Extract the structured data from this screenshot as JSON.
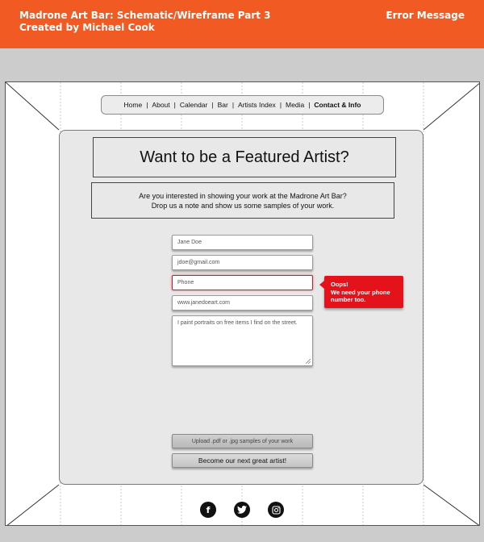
{
  "header": {
    "title_line1": "Madrone Art Bar: Schematic/Wireframe Part 3",
    "title_line2": "Created by Michael Cook",
    "page_label": "Error Message",
    "bg_color": "#f15a22"
  },
  "nav": {
    "items": [
      {
        "label": "Home"
      },
      {
        "label": "About"
      },
      {
        "label": "Calendar"
      },
      {
        "label": "Bar"
      },
      {
        "label": "Artists Index"
      },
      {
        "label": "Media"
      },
      {
        "label": "Contact & Info",
        "active": true
      }
    ],
    "separator": "|"
  },
  "main": {
    "heading": "Want to be a Featured Artist?",
    "intro_line1": "Are you interested in showing your work at the Madrone Art Bar?",
    "intro_line2": "Drop us a note and show us some samples of your work."
  },
  "form": {
    "name": {
      "placeholder": "Jane Doe"
    },
    "email": {
      "placeholder": "jdoe@gmail.com"
    },
    "phone": {
      "placeholder": "Phone",
      "state": "error"
    },
    "website": {
      "placeholder": "www.janedoeart.com"
    },
    "message": {
      "placeholder": "I paint portraits on free items I find on the street."
    },
    "upload_label": "Upload .pdf or .jpg samples of your work",
    "submit_label": "Become our next great artist!"
  },
  "error_tooltip": {
    "line1": "Oops!",
    "line2": "We need your phone",
    "line3": "number too.",
    "color": "#e3121b"
  },
  "social": {
    "icons": [
      "facebook-icon",
      "twitter-icon",
      "instagram-icon"
    ]
  }
}
